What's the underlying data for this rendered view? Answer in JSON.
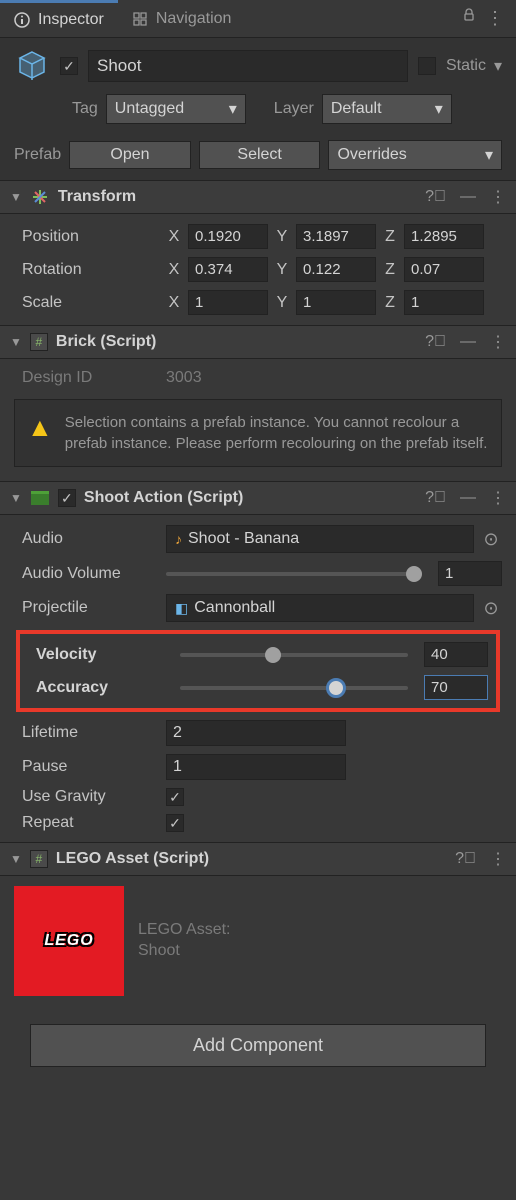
{
  "tabs": {
    "inspector": "Inspector",
    "navigation": "Navigation"
  },
  "header": {
    "name": "Shoot",
    "static_label": "Static",
    "tag_label": "Tag",
    "tag_value": "Untagged",
    "layer_label": "Layer",
    "layer_value": "Default"
  },
  "prefab": {
    "label": "Prefab",
    "open": "Open",
    "select": "Select",
    "overrides": "Overrides"
  },
  "transform": {
    "title": "Transform",
    "position_label": "Position",
    "px": "0.1920",
    "py": "3.1897",
    "pz": "1.2895",
    "rotation_label": "Rotation",
    "rx": "0.374",
    "ry": "0.122",
    "rz": "0.07",
    "scale_label": "Scale",
    "sx": "1",
    "sy": "1",
    "sz": "1"
  },
  "brick": {
    "title": "Brick (Script)",
    "design_id_label": "Design ID",
    "design_id_value": "3003",
    "warning": "Selection contains a prefab instance. You cannot recolour a prefab instance. Please perform recolouring on the prefab itself."
  },
  "shoot": {
    "title": "Shoot Action (Script)",
    "audio_label": "Audio",
    "audio_value": "Shoot - Banana",
    "audio_volume_label": "Audio Volume",
    "audio_volume_value": "1",
    "projectile_label": "Projectile",
    "projectile_value": "Cannonball",
    "velocity_label": "Velocity",
    "velocity_value": "40",
    "accuracy_label": "Accuracy",
    "accuracy_value": "70",
    "lifetime_label": "Lifetime",
    "lifetime_value": "2",
    "pause_label": "Pause",
    "pause_value": "1",
    "use_gravity_label": "Use Gravity",
    "repeat_label": "Repeat"
  },
  "lego": {
    "title": "LEGO Asset (Script)",
    "asset_label": "LEGO Asset:",
    "asset_name": "Shoot",
    "logo_text": "LEGO"
  },
  "add_component": "Add Component",
  "axes": {
    "x": "X",
    "y": "Y",
    "z": "Z"
  }
}
